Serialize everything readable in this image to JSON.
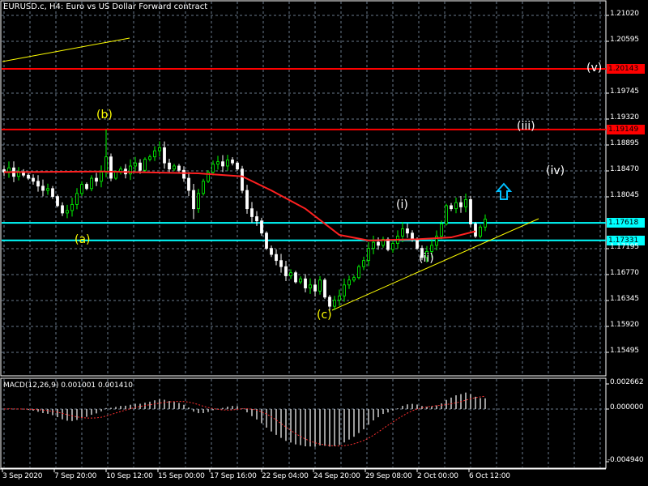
{
  "title": "EURUSD.c, H4:  Euro vs US Dollar Forward contract",
  "macd_label": "MACD(12,26,9) 0.001001 0.001410",
  "price_ticks": [
    "1.21020",
    "1.20595",
    "1.19745",
    "1.19320",
    "1.18895",
    "1.18470",
    "1.18045",
    "1.17195",
    "1.16770",
    "1.16345",
    "1.15920",
    "1.15495"
  ],
  "price_tick_values": [
    1.2102,
    1.20595,
    1.19745,
    1.1932,
    1.18895,
    1.1847,
    1.18045,
    1.17195,
    1.1677,
    1.16345,
    1.1592,
    1.15495
  ],
  "macd_ticks": [
    "0.002662",
    "0.000000",
    "-0.004940"
  ],
  "time_ticks": [
    "3 Sep 2020",
    "7 Sep 20:00",
    "10 Sep 12:00",
    "15 Sep 00:00",
    "17 Sep 16:00",
    "22 Sep 04:00",
    "24 Sep 20:00",
    "29 Sep 08:00",
    "2 Oct 00:00",
    "6 Oct 12:00"
  ],
  "levels": [
    {
      "label": "1.20143",
      "price": 1.20143,
      "color": "#ff0000"
    },
    {
      "label": "1.19149",
      "price": 1.19149,
      "color": "#ff0000"
    },
    {
      "label": "1.17618",
      "price": 1.17618,
      "color": "#00ffff"
    },
    {
      "label": "1.17331",
      "price": 1.17331,
      "color": "#00ffff"
    }
  ],
  "wave_labels": [
    {
      "text": "(v)",
      "color": "#ffffff"
    },
    {
      "text": "(iii)",
      "color": "#ffffff"
    },
    {
      "text": "(iv)",
      "color": "#ffffff"
    },
    {
      "text": "(i)",
      "color": "#ffffff"
    },
    {
      "text": "(ii)",
      "color": "#ffffff"
    },
    {
      "text": "(a)",
      "color": "#ffff00"
    },
    {
      "text": "(b)",
      "color": "#ffff00"
    },
    {
      "text": "(c)",
      "color": "#ffff00"
    }
  ],
  "colors": {
    "bull": "#00ff00",
    "bear": "#ffffff",
    "ma": "#ff2020",
    "trend": "#ffff00",
    "arrow": "#00bfff",
    "grid": "#6a7a8c"
  },
  "chart_data": {
    "type": "candlestick",
    "symbol": "EURUSD.c",
    "timeframe": "H4",
    "ylim": [
      1.1525,
      1.2125
    ],
    "closes": [
      1.1845,
      1.1852,
      1.1838,
      1.1846,
      1.184,
      1.1835,
      1.183,
      1.1822,
      1.1815,
      1.1818,
      1.1805,
      1.179,
      1.1778,
      1.1782,
      1.1792,
      1.181,
      1.1825,
      1.1818,
      1.1835,
      1.183,
      1.1845,
      1.187,
      1.1835,
      1.1845,
      1.185,
      1.1842,
      1.1855,
      1.186,
      1.1848,
      1.1866,
      1.187,
      1.188,
      1.1885,
      1.186,
      1.185,
      1.1855,
      1.1848,
      1.1835,
      1.1815,
      1.1785,
      1.181,
      1.183,
      1.1845,
      1.1858,
      1.1862,
      1.1855,
      1.1865,
      1.186,
      1.185,
      1.1815,
      1.1785,
      1.1772,
      1.1765,
      1.1745,
      1.172,
      1.171,
      1.17,
      1.169,
      1.1675,
      1.168,
      1.1665,
      1.167,
      1.1655,
      1.166,
      1.165,
      1.1668,
      1.164,
      1.1625,
      1.1635,
      1.1642,
      1.166,
      1.1668,
      1.1672,
      1.169,
      1.17,
      1.172,
      1.173,
      1.1725,
      1.1735,
      1.1718,
      1.1728,
      1.174,
      1.1752,
      1.1745,
      1.1735,
      1.172,
      1.1705,
      1.1715,
      1.1725,
      1.174,
      1.176,
      1.179,
      1.1785,
      1.1795,
      1.1788,
      1.18,
      1.176,
      1.174,
      1.1755,
      1.1768
    ],
    "spikes": {
      "21": 1.1915,
      "39": 1.1768,
      "67": 1.1618
    },
    "moving_average": [
      [
        0,
        1.1845
      ],
      [
        20,
        1.1846
      ],
      [
        40,
        1.1843
      ],
      [
        49,
        1.1838
      ],
      [
        55,
        1.1815
      ],
      [
        62,
        1.1785
      ],
      [
        69,
        1.1742
      ],
      [
        75,
        1.1733
      ],
      [
        85,
        1.1735
      ],
      [
        92,
        1.1738
      ],
      [
        97,
        1.1748
      ]
    ],
    "macd_range": [
      -0.00494,
      0.002662
    ]
  }
}
